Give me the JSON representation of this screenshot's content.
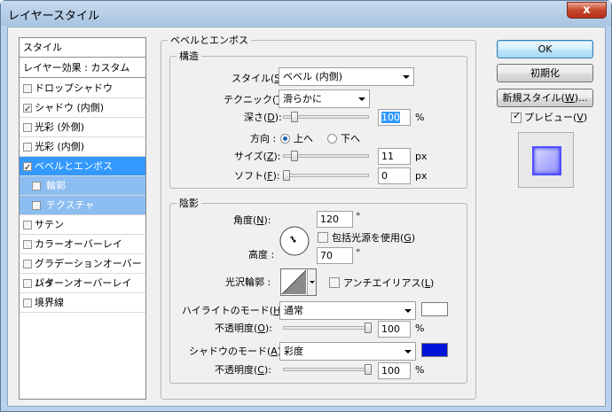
{
  "window": {
    "title": "レイヤースタイル",
    "close_glyph": "x"
  },
  "sidebar": {
    "header": "スタイル",
    "blend": "レイヤー効果 : カスタム",
    "items": [
      {
        "label": "ドロップシャドウ",
        "checked": false
      },
      {
        "label": "シャドウ (内側)",
        "checked": true
      },
      {
        "label": "光彩 (外側)",
        "checked": false
      },
      {
        "label": "光彩 (内側)",
        "checked": false
      },
      {
        "label": "ベベルとエンボス",
        "checked": true
      },
      {
        "label": "輪郭",
        "checked": false
      },
      {
        "label": "テクスチャ",
        "checked": false
      },
      {
        "label": "サテン",
        "checked": false
      },
      {
        "label": "カラーオーバーレイ",
        "checked": false
      },
      {
        "label": "グラデーションオーバーレイ",
        "checked": false
      },
      {
        "label": "パターンオーバーレイ",
        "checked": false
      },
      {
        "label": "境界線",
        "checked": false
      }
    ]
  },
  "bevel": {
    "group_title": "ベベルとエンボス",
    "structure": {
      "title": "構造",
      "style_label": "スタイル(",
      "style_key": "S",
      "style_value": "ベベル (内側)",
      "technique_label": "テクニック(",
      "technique_key": "T",
      "technique_value": "滑らかに",
      "depth_label": "深さ(",
      "depth_key": "D",
      "depth_value": "100",
      "depth_level": 0.1,
      "depth_unit": "%",
      "direction_label": "方向 :",
      "dir_up": "上へ",
      "dir_down": "下へ",
      "size_label": "サイズ(",
      "size_key": "Z",
      "size_value": "11",
      "size_level": 0.1,
      "size_unit": "px",
      "soften_label": "ソフト(",
      "soften_key": "F",
      "soften_value": "0",
      "soften_level": 0,
      "soften_unit": "px"
    },
    "shading": {
      "title": "陰影",
      "angle_label": "角度(",
      "angle_key": "N",
      "angle_value": "120",
      "angle_unit": "°",
      "global_light": "包括光源を使用(",
      "global_key": "G",
      "altitude_label": "高度 :",
      "altitude_value": "70",
      "altitude_unit": "°",
      "gloss_label": "光沢輪郭 :",
      "antialias": "アンチエイリアス(",
      "antialias_key": "L",
      "highlight_label": "ハイライトのモード(",
      "highlight_key": "H",
      "highlight_mode": "通常",
      "highlight_color": "#ffffff",
      "opacity1_label": "不透明度(",
      "opacity1_key": "O",
      "opacity1_value": "100",
      "opacity1_unit": "%",
      "opacity1_level": 1,
      "shadow_label": "シャドウのモード(",
      "shadow_key": "A",
      "shadow_mode": "彩度",
      "shadow_color": "#0014d8",
      "opacity2_label": "不透明度(",
      "opacity2_key": "C",
      "opacity2_value": "100",
      "opacity2_unit": "%",
      "opacity2_level": 1
    }
  },
  "buttons": {
    "ok": "OK",
    "reset": "初期化",
    "new_style": "新規スタイル(",
    "new_style_key": "W",
    "new_style_tail": ")...",
    "preview": "プレビュー(",
    "preview_key": "V"
  },
  "close_paren": "):",
  "paren": ")"
}
